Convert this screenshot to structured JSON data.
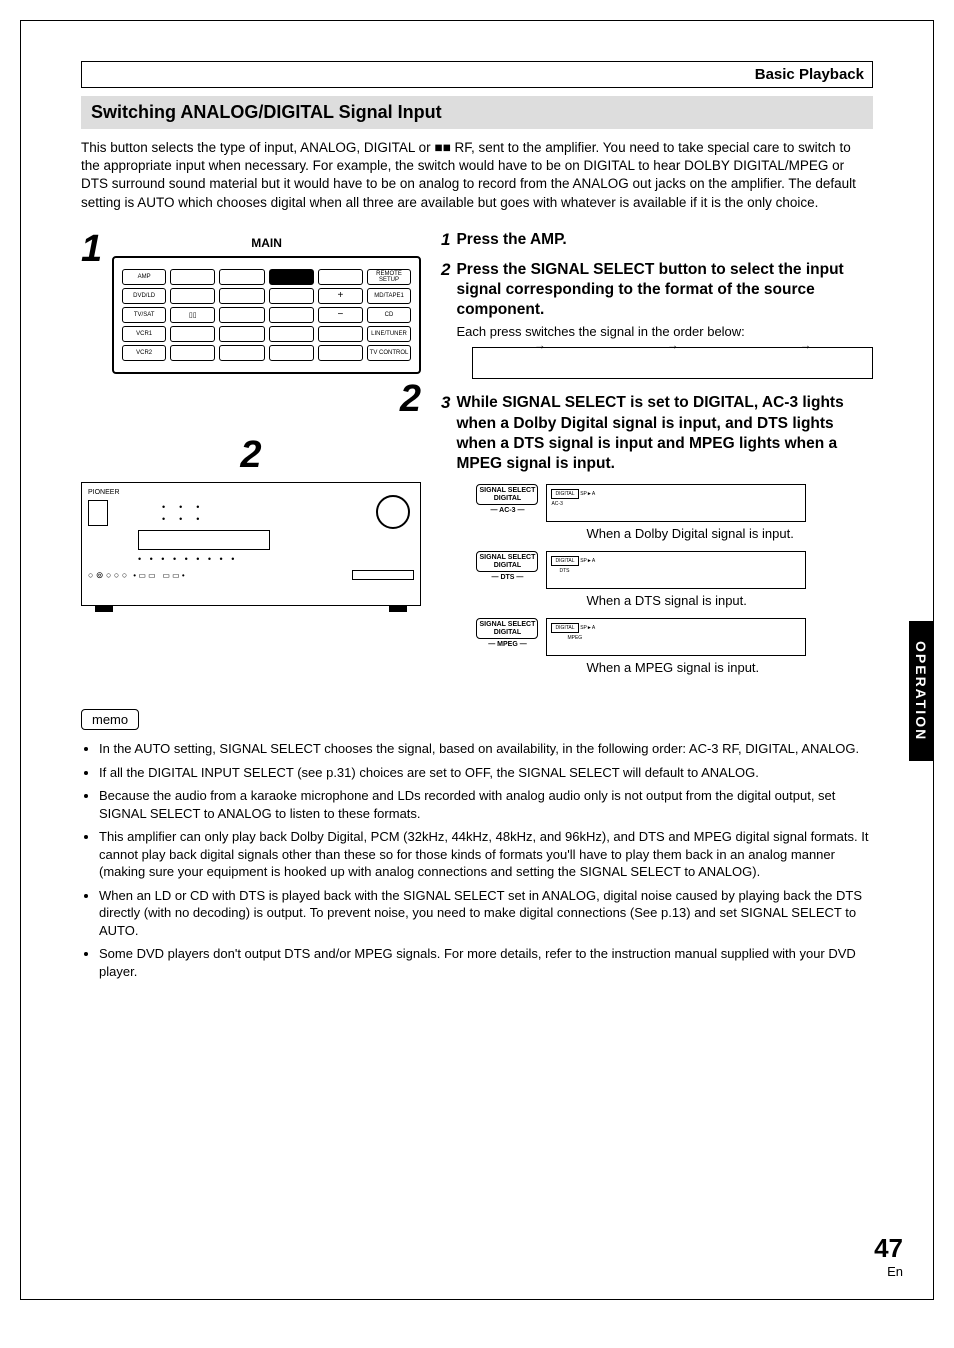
{
  "header": {
    "section": "Basic Playback"
  },
  "title": "Switching ANALOG/DIGITAL Signal Input",
  "intro": "This button selects the type of input, ANALOG, DIGITAL or ■■ RF, sent to the amplifier. You need to take special care to switch to the appropriate input when necessary. For  example, the switch would have to be on DIGITAL to hear DOLBY DIGITAL/MPEG or DTS surround sound material but it would have to be on analog to record from the ANALOG out jacks on the amplifier. The default setting is AUTO which chooses digital when all three are available but goes with whatever is available if it is the only choice.",
  "remote": {
    "label_main": "MAIN",
    "side_left": [
      "AMP",
      "DVD/LD",
      "TV/SAT",
      "VCR1",
      "VCR2"
    ],
    "side_right": [
      "REMOTE SETUP",
      "MD/TAPE1",
      "CD",
      "LINE/TUNER",
      "TV CONTROL"
    ],
    "big1": "1",
    "big2_a": "2",
    "big2_b": "2"
  },
  "steps": {
    "s1": {
      "num": "1",
      "title": "Press the AMP."
    },
    "s2": {
      "num": "2",
      "title": "Press the SIGNAL SELECT button to select the input signal corresponding to the format of the source component.",
      "text": "Each press switches the signal in the order below:"
    },
    "s3": {
      "num": "3",
      "title": "While SIGNAL SELECT is set to DIGITAL, AC-3 lights when a Dolby Digital signal is input, and DTS lights when a DTS signal is input and MPEG lights when a MPEG signal is input."
    }
  },
  "signal": {
    "btn_top": "SIGNAL SELECT",
    "btn_mid": "DIGITAL",
    "ind_ac3": "AC-3",
    "ind_dts": "DTS",
    "ind_mpeg": "MPEG",
    "cap_ac3": "When a Dolby Digital signal is input.",
    "cap_dts": "When a DTS signal is input.",
    "cap_mpeg": "When a MPEG signal is input."
  },
  "memo_label": "memo",
  "bullets": [
    "In the AUTO setting, SIGNAL SELECT chooses the signal, based on availability,  in the following order: AC-3 RF, DIGITAL, ANALOG.",
    "If all the DIGITAL INPUT SELECT (see p.31) choices are set to OFF, the SIGNAL SELECT will default to ANALOG.",
    "Because the audio from a karaoke microphone and LDs recorded with analog audio only is not output from the digital output, set SIGNAL SELECT to ANALOG to listen to these formats.",
    "This amplifier can only play back Dolby Digital, PCM (32kHz, 44kHz, 48kHz, and 96kHz), and DTS and MPEG digital signal formats. It cannot play back digital signals other than these so for those kinds of formats you'll have to play them back in an analog manner (making sure your equipment is hooked up with analog connections and setting the SIGNAL SELECT to ANALOG).",
    "When an LD or CD with DTS is played back with the SIGNAL SELECT set in ANALOG, digital noise caused by playing back the DTS directly (with no decoding) is output. To prevent noise, you need to make digital connections (See p.13) and set SIGNAL SELECT to AUTO.",
    "Some DVD players don't output DTS and/or MPEG signals. For more details, refer to the instruction manual supplied with your DVD player."
  ],
  "side_tab": "OPERATION",
  "page": {
    "num": "47",
    "lang": "En"
  }
}
